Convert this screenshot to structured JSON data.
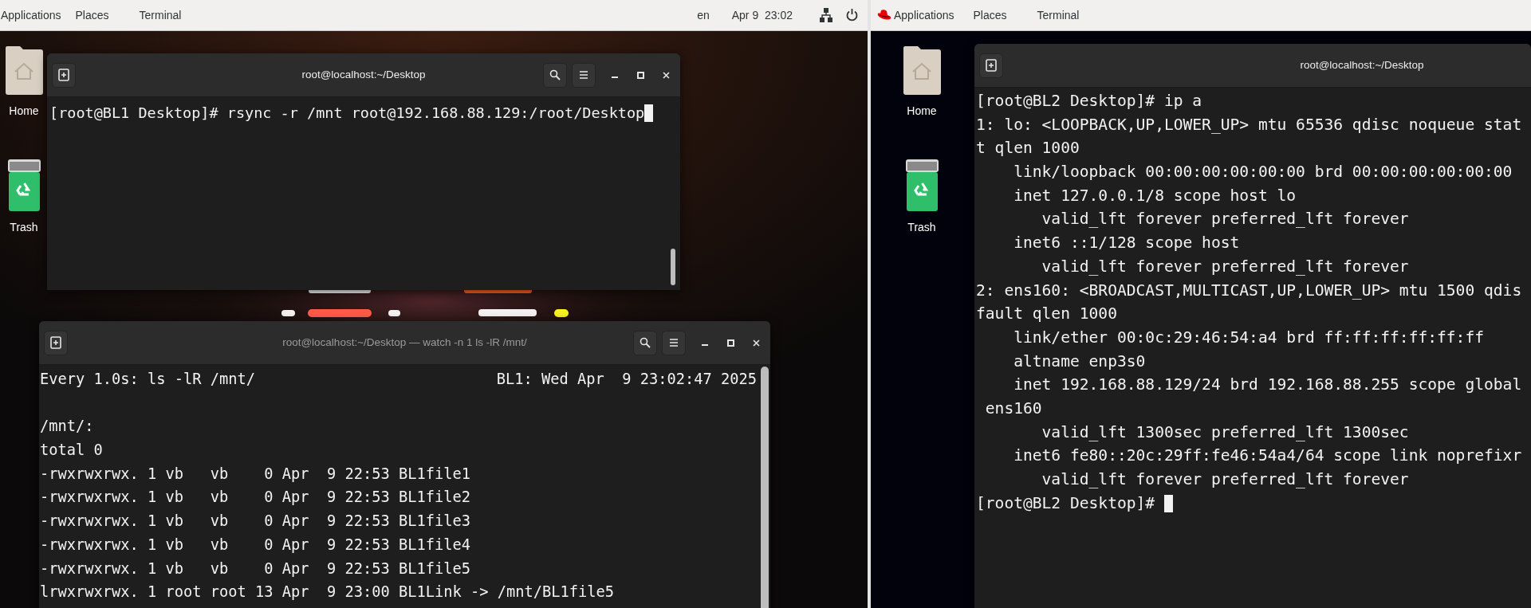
{
  "left_screen": {
    "top_bar": {
      "menus": [
        "Applications",
        "Places",
        "Terminal"
      ],
      "language": "en",
      "clock": "Apr 9  23:02"
    },
    "desktop_icons": [
      {
        "label": "Home",
        "kind": "home"
      },
      {
        "label": "Trash",
        "kind": "trash"
      }
    ],
    "windows": [
      {
        "title": "root@localhost:~/Desktop",
        "active": true,
        "cursor": true,
        "lines": [
          "[root@BL1 Desktop]# rsync -r /mnt root@192.168.88.129:/root/Desktop"
        ]
      },
      {
        "title": "root@localhost:~/Desktop — watch -n 1 ls -lR /mnt/",
        "active": false,
        "cursor": false,
        "watch_header": {
          "command": "Every 1.0s: ls -lR /mnt/",
          "host_time": "BL1: Wed Apr  9 23:02:47 2025"
        },
        "lines": [
          "/mnt/:",
          "total 0",
          "-rwxrwxrwx. 1 vb   vb    0 Apr  9 22:53 BL1file1",
          "-rwxrwxrwx. 1 vb   vb    0 Apr  9 22:53 BL1file2",
          "-rwxrwxrwx. 1 vb   vb    0 Apr  9 22:53 BL1file3",
          "-rwxrwxrwx. 1 vb   vb    0 Apr  9 22:53 BL1file4",
          "-rwxrwxrwx. 1 vb   vb    0 Apr  9 22:53 BL1file5",
          "lrwxrwxrwx. 1 root root 13 Apr  9 23:00 BL1Link -> /mnt/BL1file5"
        ]
      }
    ]
  },
  "right_screen": {
    "top_bar": {
      "menus": [
        "Applications",
        "Places",
        "Terminal"
      ]
    },
    "desktop_icons": [
      {
        "label": "Home",
        "kind": "home"
      },
      {
        "label": "Trash",
        "kind": "trash"
      }
    ],
    "windows": [
      {
        "title": "root@localhost:~/Desktop",
        "active": true,
        "cursor": true,
        "lines": [
          "[root@BL2 Desktop]# ip a",
          "1: lo: <LOOPBACK,UP,LOWER_UP> mtu 65536 qdisc noqueue stat",
          "t qlen 1000",
          "    link/loopback 00:00:00:00:00:00 brd 00:00:00:00:00:00",
          "    inet 127.0.0.1/8 scope host lo",
          "       valid_lft forever preferred_lft forever",
          "    inet6 ::1/128 scope host",
          "       valid_lft forever preferred_lft forever",
          "2: ens160: <BROADCAST,MULTICAST,UP,LOWER_UP> mtu 1500 qdis",
          "fault qlen 1000",
          "    link/ether 00:0c:29:46:54:a4 brd ff:ff:ff:ff:ff:ff",
          "    altname enp3s0",
          "    inet 192.168.88.129/24 brd 192.168.88.255 scope global",
          " ens160",
          "       valid_lft 1300sec preferred_lft 1300sec",
          "    inet6 fe80::20c:29ff:fe46:54a4/64 scope link noprefixr",
          "       valid_lft forever preferred_lft forever",
          "[root@BL2 Desktop]# "
        ]
      }
    ]
  }
}
